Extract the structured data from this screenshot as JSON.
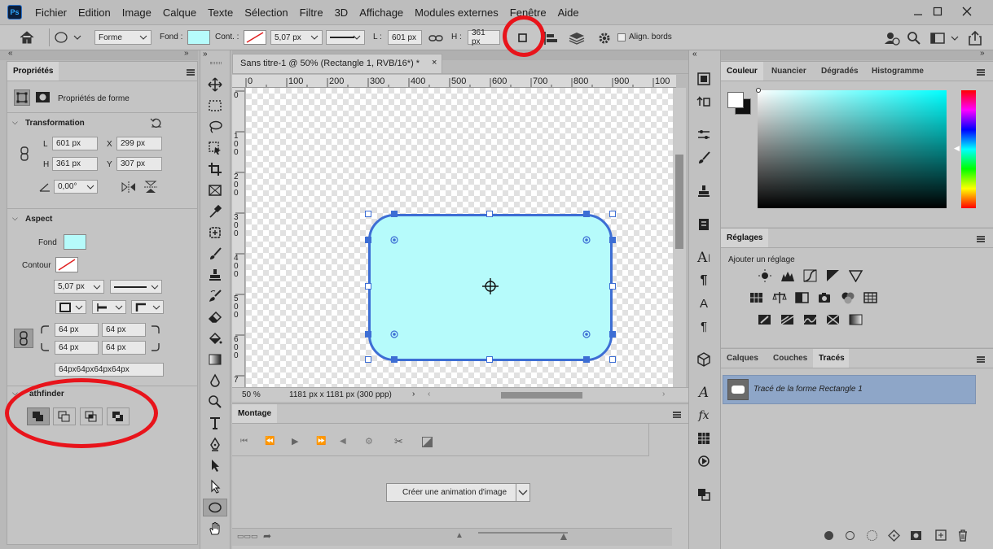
{
  "menubar": {
    "app_logo": "Ps",
    "items": [
      "Fichier",
      "Edition",
      "Image",
      "Calque",
      "Texte",
      "Sélection",
      "Filtre",
      "3D",
      "Affichage",
      "Modules externes",
      "Fenêtre",
      "Aide"
    ]
  },
  "options_bar": {
    "mode": "Forme",
    "fill_label": "Fond :",
    "stroke_label": "Cont. :",
    "stroke_width": "5,07 px",
    "w_label": "L :",
    "w_value": "601 px",
    "h_label": "H :",
    "h_value": "361 px",
    "align_edges_label": "Align. bords"
  },
  "properties": {
    "tab": "Propriétés",
    "subtitle": "Propriétés de forme",
    "transform_title": "Transformation",
    "l_label": "L",
    "l_value": "601 px",
    "x_label": "X",
    "x_value": "299 px",
    "h_label": "H",
    "h_value": "361 px",
    "y_label": "Y",
    "y_value": "307 px",
    "angle_value": "0,00°",
    "aspect_title": "Aspect",
    "fill_label": "Fond",
    "stroke_label": "Contour",
    "stroke_width": "5,07 px",
    "corner_tl": "64 px",
    "corner_tr": "64 px",
    "corner_bl": "64 px",
    "corner_br": "64 px",
    "corners_combined": "64px64px64px64px",
    "pathfinder_title": "athfinder"
  },
  "document": {
    "tab_title": "Sans titre-1 @ 50% (Rectangle 1, RVB/16*) *",
    "ruler_top": [
      "0",
      "100",
      "200",
      "300",
      "400",
      "500",
      "600",
      "700",
      "800",
      "900",
      "100"
    ],
    "ruler_left": [
      "0",
      "1\n0\n0",
      "2\n0\n0",
      "3\n0\n0",
      "4\n0\n0",
      "5\n0\n0",
      "6\n0\n0",
      "7"
    ],
    "zoom": "50 %",
    "doc_size": "1181 px x 1181 px (300 ppp)"
  },
  "timeline": {
    "title": "Montage",
    "create_button": "Créer une animation d'image"
  },
  "color_panel": {
    "tabs": [
      "Couleur",
      "Nuancier",
      "Dégradés",
      "Histogramme"
    ]
  },
  "adjustments_panel": {
    "title": "Réglages",
    "hint": "Ajouter un réglage"
  },
  "layers_panel": {
    "tabs": [
      "Calques",
      "Couches",
      "Tracés"
    ],
    "path_item": "Tracé de la forme Rectangle 1"
  },
  "colors": {
    "shape_fill": "#b6fbfb",
    "shape_stroke": "#3d6ed4",
    "highlight": "#e8141b",
    "selected_row": "#8ea6c8"
  }
}
